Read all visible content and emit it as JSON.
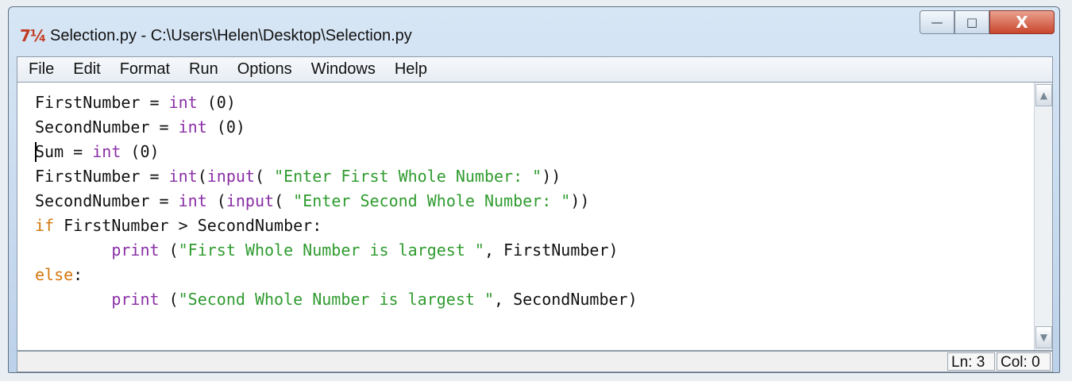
{
  "window": {
    "icon_text": "7¼",
    "title": "Selection.py - C:\\Users\\Helen\\Desktop\\Selection.py",
    "buttons": {
      "minimize": "—",
      "maximize": "□",
      "close": "X"
    }
  },
  "menu": {
    "items": [
      "File",
      "Edit",
      "Format",
      "Run",
      "Options",
      "Windows",
      "Help"
    ]
  },
  "editor": {
    "lines": [
      [
        {
          "text": "FirstNumber = ",
          "type": "plain"
        },
        {
          "text": "int",
          "type": "builtin"
        },
        {
          "text": " (0)",
          "type": "plain"
        }
      ],
      [
        {
          "text": "SecondNumber = ",
          "type": "plain"
        },
        {
          "text": "int",
          "type": "builtin"
        },
        {
          "text": " (0)",
          "type": "plain"
        }
      ],
      [
        {
          "text": "Sum = ",
          "type": "plain"
        },
        {
          "text": "int",
          "type": "builtin"
        },
        {
          "text": " (0)",
          "type": "plain"
        }
      ],
      [
        {
          "text": "FirstNumber = ",
          "type": "plain"
        },
        {
          "text": "int",
          "type": "builtin"
        },
        {
          "text": "(",
          "type": "plain"
        },
        {
          "text": "input",
          "type": "builtin"
        },
        {
          "text": "( ",
          "type": "plain"
        },
        {
          "text": "\"Enter First Whole Number: \"",
          "type": "string"
        },
        {
          "text": "))",
          "type": "plain"
        }
      ],
      [
        {
          "text": "SecondNumber = ",
          "type": "plain"
        },
        {
          "text": "int",
          "type": "builtin"
        },
        {
          "text": " (",
          "type": "plain"
        },
        {
          "text": "input",
          "type": "builtin"
        },
        {
          "text": "( ",
          "type": "plain"
        },
        {
          "text": "\"Enter Second Whole Number: \"",
          "type": "string"
        },
        {
          "text": "))",
          "type": "plain"
        }
      ],
      [
        {
          "text": "if",
          "type": "keyword"
        },
        {
          "text": " FirstNumber > SecondNumber:",
          "type": "plain"
        }
      ],
      [
        {
          "text": "        ",
          "type": "plain"
        },
        {
          "text": "print",
          "type": "builtin"
        },
        {
          "text": " (",
          "type": "plain"
        },
        {
          "text": "\"First Whole Number is largest \"",
          "type": "string"
        },
        {
          "text": ", FirstNumber)",
          "type": "plain"
        }
      ],
      [
        {
          "text": "else",
          "type": "keyword"
        },
        {
          "text": ":",
          "type": "plain"
        }
      ],
      [
        {
          "text": "        ",
          "type": "plain"
        },
        {
          "text": "print",
          "type": "builtin"
        },
        {
          "text": " (",
          "type": "plain"
        },
        {
          "text": "\"Second Whole Number is largest \"",
          "type": "string"
        },
        {
          "text": ", SecondNumber)",
          "type": "plain"
        }
      ]
    ]
  },
  "status": {
    "line": "Ln: 3",
    "column": "Col: 0"
  },
  "colors": {
    "keyword": "#d4770f",
    "builtin": "#8a2fa6",
    "string": "#2f9b2f"
  }
}
